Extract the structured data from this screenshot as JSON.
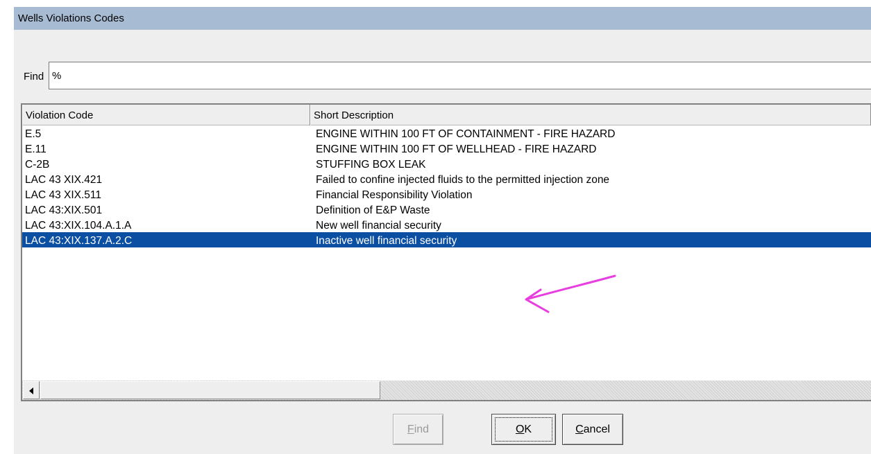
{
  "window": {
    "title": "Wells Violations Codes"
  },
  "find": {
    "label": "Find",
    "value": "%"
  },
  "grid": {
    "columns": [
      "Violation Code",
      "Short Description"
    ],
    "rows": [
      {
        "code": "E.5",
        "description": "ENGINE WITHIN 100 FT OF CONTAINMENT - FIRE HAZARD"
      },
      {
        "code": "E.11",
        "description": "ENGINE WITHIN 100 FT OF WELLHEAD - FIRE HAZARD"
      },
      {
        "code": "C-2B",
        "description": "STUFFING BOX LEAK"
      },
      {
        "code": "LAC 43 XIX.421",
        "description": "Failed to confine injected fluids to the permitted injection zone"
      },
      {
        "code": "LAC 43 XIX.511",
        "description": "Financial Responsibility Violation"
      },
      {
        "code": "LAC 43:XIX.501",
        "description": "Definition of E&P Waste"
      },
      {
        "code": "LAC 43:XIX.104.A.1.A",
        "description": "New well financial security"
      },
      {
        "code": "LAC 43:XIX.137.A.2.C",
        "description": "Inactive well financial security"
      }
    ],
    "selected_row": 7
  },
  "buttons": {
    "find": {
      "first": "F",
      "rest": "ind",
      "enabled": false
    },
    "ok": {
      "first": "O",
      "rest": "K"
    },
    "cancel": {
      "first": "C",
      "rest": "ancel"
    }
  },
  "colors": {
    "title_bar": "#a7bbd3",
    "selection": "#0b4fa3",
    "annotation_arrow": "#e83ee0"
  }
}
